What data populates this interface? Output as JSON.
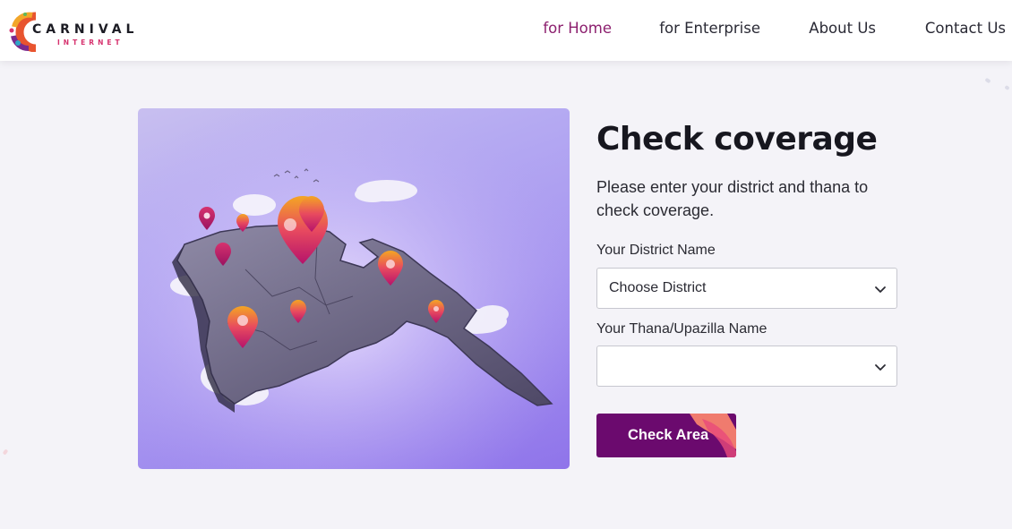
{
  "brand": {
    "name": "CARNIVAL",
    "tagline": "INTERNET",
    "colors": {
      "primary": "#6b0a6e",
      "accent": "#8c1f6e",
      "pink": "#d6326e"
    }
  },
  "nav": {
    "items": [
      {
        "label": "for Home",
        "active": true
      },
      {
        "label": "for Enterprise",
        "active": false
      },
      {
        "label": "About Us",
        "active": false
      },
      {
        "label": "Contact Us",
        "active": false
      }
    ]
  },
  "hero": {
    "image_icon": "map-with-location-pins"
  },
  "coverage": {
    "title": "Check coverage",
    "subtitle": "Please enter your district and thana to check coverage.",
    "district": {
      "label": "Your District Name",
      "value": "Choose District"
    },
    "thana": {
      "label": "Your Thana/Upazilla Name",
      "value": ""
    },
    "button_label": "Check Area"
  }
}
